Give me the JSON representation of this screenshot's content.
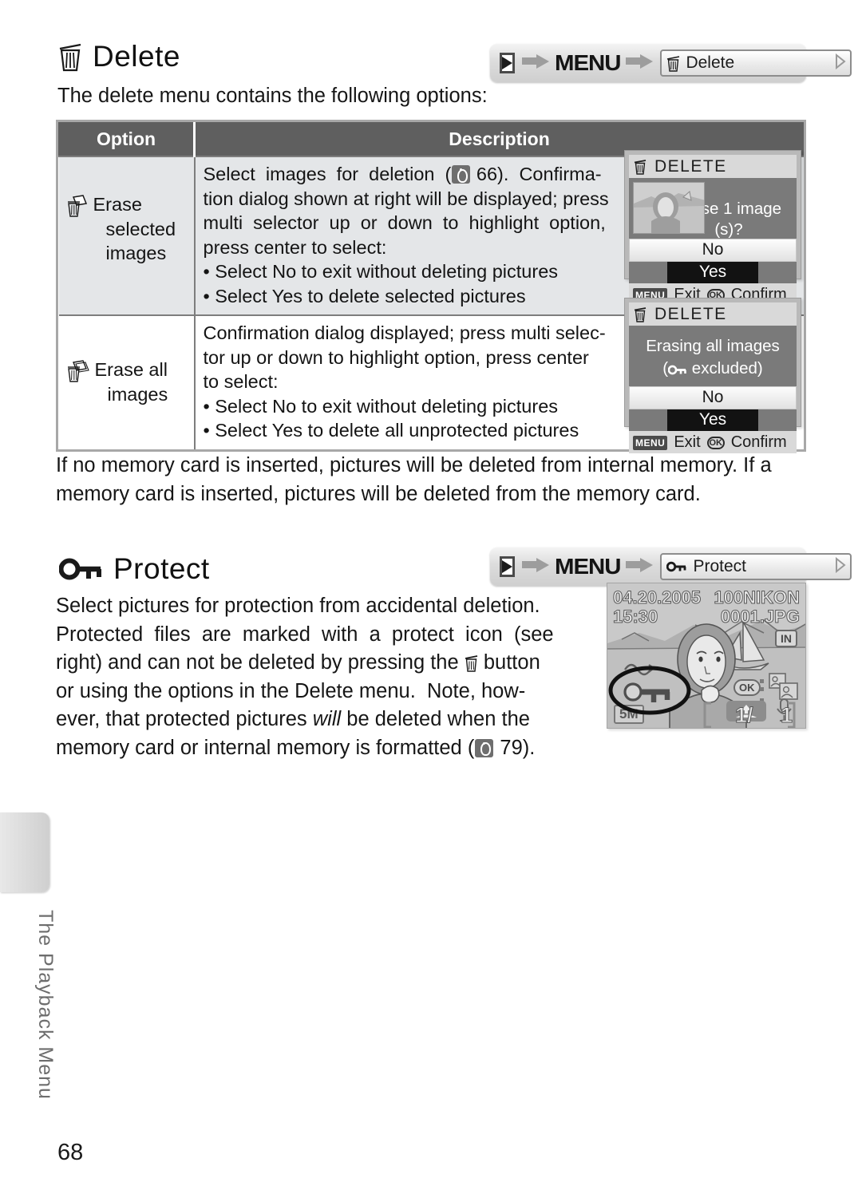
{
  "page": {
    "number": "68",
    "side_tab_label": "The Playback Menu"
  },
  "sections": {
    "delete": {
      "heading": "Delete",
      "heading_icon": "trash-icon",
      "intro": "The delete menu contains the following options:",
      "breadcrumb": {
        "playback_icon": "playback-button-icon",
        "menu_label": "MENU",
        "target_icon": "trash-icon",
        "target_label": "Delete"
      },
      "table": {
        "headers": [
          "Option",
          "Description"
        ],
        "rows": [
          {
            "option_icon": "erase-selected-icon",
            "option_label_line1": "Erase",
            "option_label_line2": "selected",
            "option_label_line3": "images",
            "description_main": "Select images for deletion (  66).  Confirmation dialog shown at right will be displayed; press multi selector up or down to highlight option, press center to select:",
            "ref_page": "66",
            "bullets": [
              "• Select No to exit without deleting pictures",
              "• Select Yes to delete selected pictures"
            ]
          },
          {
            "option_icon": "erase-all-icon",
            "option_label_line1": "Erase all",
            "option_label_line2": "images",
            "option_label_line3": "",
            "description_main": "Confirmation dialog displayed; press multi selector up or down to highlight option, press center to select:",
            "ref_page": "",
            "bullets": [
              "• Select No to exit without deleting pictures",
              "• Select Yes to delete all unprotected pictures"
            ]
          }
        ]
      },
      "note": "If no memory card is inserted, pictures will be deleted from internal memory. If a memory card is inserted, pictures will be deleted from the memory card."
    },
    "protect": {
      "heading": "Protect",
      "heading_icon": "key-protect-icon",
      "breadcrumb": {
        "playback_icon": "playback-button-icon",
        "menu_label": "MENU",
        "target_icon": "key-protect-icon",
        "target_label": "Protect"
      },
      "body_lines": [
        "Select pictures for protection from accidental deletion.",
        "Protected files are marked with a protect icon (see",
        "right) and can not be deleted by pressing the",
        "button or using the options in the Delete menu.  Note, how-",
        "ever, that protected pictures will be deleted when the",
        "memory card or internal memory is formatted (",
        "79)."
      ],
      "body_ref_page": "79",
      "body_italic_word": "will"
    }
  },
  "lcd_screens": [
    {
      "name": "delete-selected-dialog",
      "title": "DELETE",
      "title_icon": "trash-icon",
      "message": "Erase 1 image (s)?",
      "has_thumbnail": true,
      "options": [
        "No",
        "Yes"
      ],
      "selected_option": "Yes",
      "footer": {
        "menu_badge": "MENU",
        "menu_label": "Exit",
        "ok_badge": "OK",
        "ok_label": "Confirm"
      }
    },
    {
      "name": "delete-all-dialog",
      "title": "DELETE",
      "title_icon": "trash-icon",
      "message_line1": "Erasing all images",
      "message_line2_pre": "(",
      "message_line2_icon": "key-protect-icon",
      "message_line2_post": " excluded)",
      "has_thumbnail": false,
      "options": [
        "No",
        "Yes"
      ],
      "selected_option": "Yes",
      "footer": {
        "menu_badge": "MENU",
        "menu_label": "Exit",
        "ok_badge": "OK",
        "ok_label": "Confirm"
      }
    }
  ],
  "playback_screen": {
    "name": "protect-playback-preview",
    "date": "04.20.2005",
    "time": "15:30",
    "folder": "100NIKON",
    "filename": "0001.JPG",
    "memory_badge": "IN",
    "size_badge": "5M",
    "frame_current": "1/",
    "frame_total": "1",
    "ok_badge": "OK",
    "protect_icon": "key-protect-icon",
    "transfer_icon": "transfer-mark-icon",
    "voice_icon": "microphone-icon",
    "crop_icon": "small-picture-icon",
    "scene_icon": "scene-mode-icon"
  }
}
